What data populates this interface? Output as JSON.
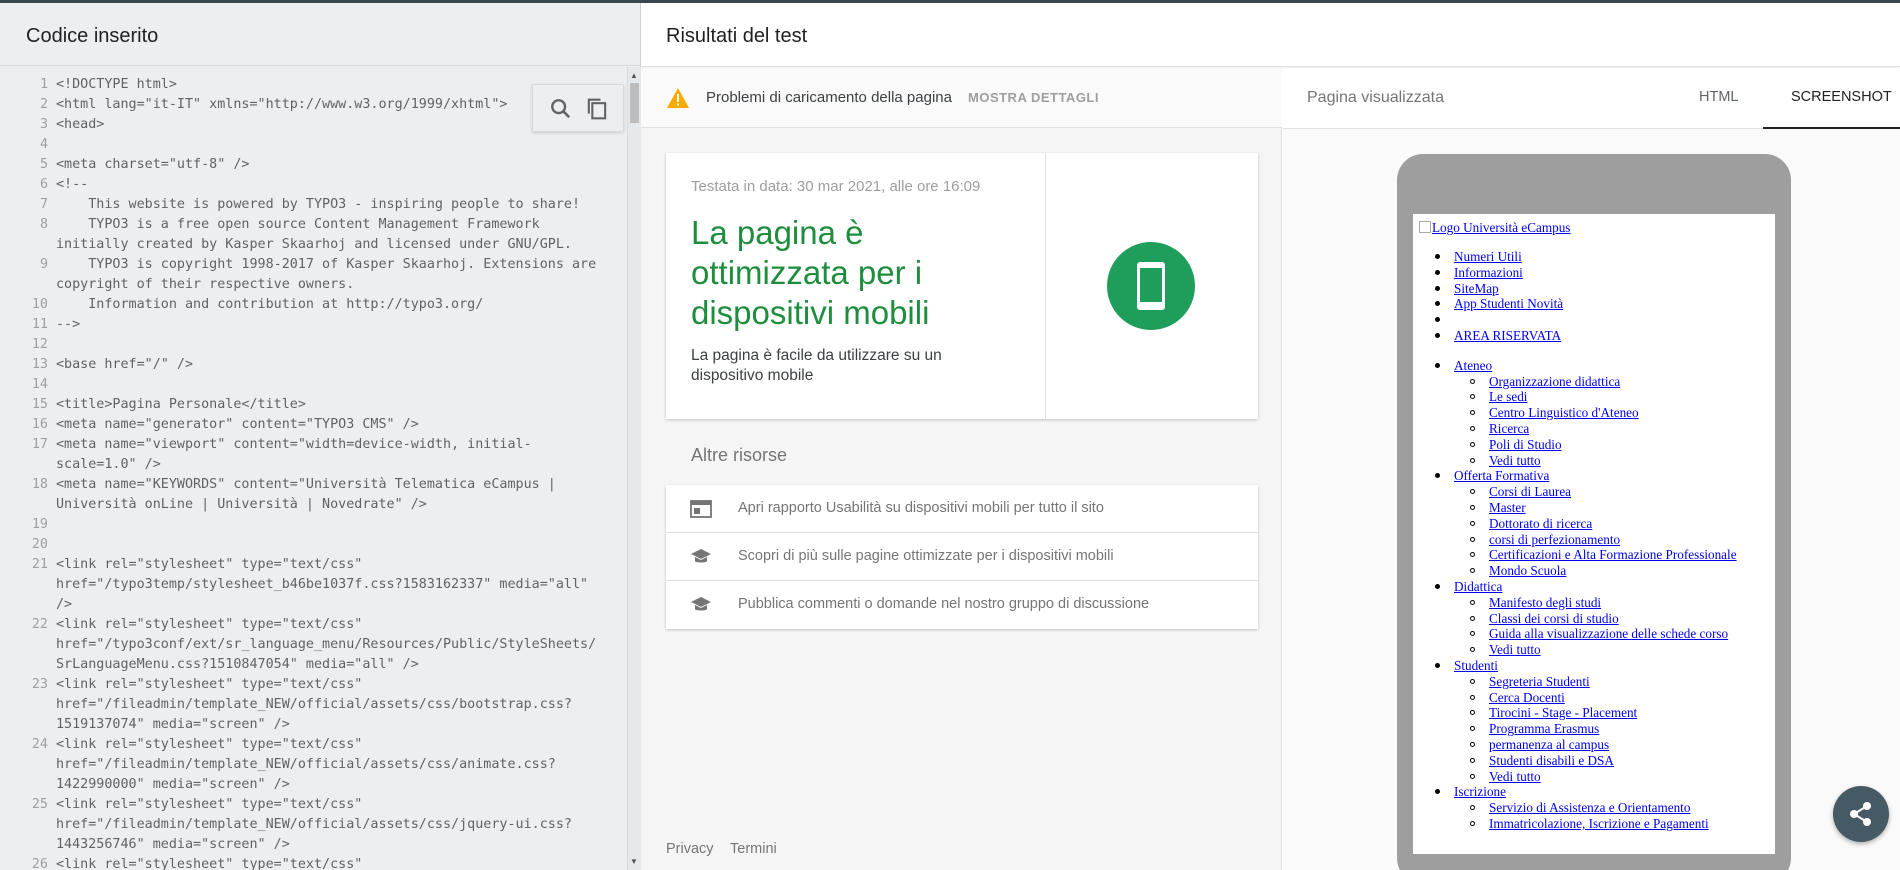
{
  "left_panel": {
    "title": "Codice inserito",
    "code_lines": [
      {
        "n": "1",
        "t": "<!DOCTYPE html>"
      },
      {
        "n": "2",
        "t": "<html lang=\"it-IT\" xmlns=\"http://www.w3.org/1999/xhtml\">"
      },
      {
        "n": "3",
        "t": "<head>"
      },
      {
        "n": "4",
        "t": ""
      },
      {
        "n": "5",
        "t": "<meta charset=\"utf-8\" />"
      },
      {
        "n": "6",
        "t": "<!--"
      },
      {
        "n": "7",
        "t": "    This website is powered by TYPO3 - inspiring people to share!"
      },
      {
        "n": "8",
        "t": "    TYPO3 is a free open source Content Management Framework"
      },
      {
        "n": "",
        "t": "initially created by Kasper Skaarhoj and licensed under GNU/GPL."
      },
      {
        "n": "9",
        "t": "    TYPO3 is copyright 1998-2017 of Kasper Skaarhoj. Extensions are"
      },
      {
        "n": "",
        "t": "copyright of their respective owners."
      },
      {
        "n": "10",
        "t": "    Information and contribution at http://typo3.org/"
      },
      {
        "n": "11",
        "t": "-->"
      },
      {
        "n": "12",
        "t": ""
      },
      {
        "n": "13",
        "t": "<base href=\"/\" />"
      },
      {
        "n": "14",
        "t": ""
      },
      {
        "n": "15",
        "t": "<title>Pagina Personale</title>"
      },
      {
        "n": "16",
        "t": "<meta name=\"generator\" content=\"TYPO3 CMS\" />"
      },
      {
        "n": "17",
        "t": "<meta name=\"viewport\" content=\"width=device-width, initial-"
      },
      {
        "n": "",
        "t": "scale=1.0\" />"
      },
      {
        "n": "18",
        "t": "<meta name=\"KEYWORDS\" content=\"Università Telematica eCampus |"
      },
      {
        "n": "",
        "t": "Università onLine | Università | Novedrate\" />"
      },
      {
        "n": "19",
        "t": ""
      },
      {
        "n": "20",
        "t": ""
      },
      {
        "n": "21",
        "t": "<link rel=\"stylesheet\" type=\"text/css\""
      },
      {
        "n": "",
        "t": "href=\"/typo3temp/stylesheet_b46be1037f.css?1583162337\" media=\"all\""
      },
      {
        "n": "",
        "t": "/>"
      },
      {
        "n": "22",
        "t": "<link rel=\"stylesheet\" type=\"text/css\""
      },
      {
        "n": "",
        "t": "href=\"/typo3conf/ext/sr_language_menu/Resources/Public/StyleSheets/"
      },
      {
        "n": "",
        "t": "SrLanguageMenu.css?1510847054\" media=\"all\" />"
      },
      {
        "n": "23",
        "t": "<link rel=\"stylesheet\" type=\"text/css\""
      },
      {
        "n": "",
        "t": "href=\"/fileadmin/template_NEW/official/assets/css/bootstrap.css?"
      },
      {
        "n": "",
        "t": "1519137074\" media=\"screen\" />"
      },
      {
        "n": "24",
        "t": "<link rel=\"stylesheet\" type=\"text/css\""
      },
      {
        "n": "",
        "t": "href=\"/fileadmin/template_NEW/official/assets/css/animate.css?"
      },
      {
        "n": "",
        "t": "1422990000\" media=\"screen\" />"
      },
      {
        "n": "25",
        "t": "<link rel=\"stylesheet\" type=\"text/css\""
      },
      {
        "n": "",
        "t": "href=\"/fileadmin/template_NEW/official/assets/css/jquery-ui.css?"
      },
      {
        "n": "",
        "t": "1443256746\" media=\"screen\" />"
      },
      {
        "n": "26",
        "t": "<link rel=\"stylesheet\" type=\"text/css\""
      }
    ]
  },
  "right_panel": {
    "title": "Risultati del test",
    "warning": {
      "text": "Problemi di caricamento della pagina",
      "action": "MOSTRA DETTAGLI",
      "color": "#f9ab00"
    },
    "result": {
      "date": "Testata in data: 30 mar 2021, alle ore 16:09",
      "verdict": "La pagina è ottimizzata per i dispositivi mobili",
      "subtitle": "La pagina è facile da utilizzare su un dispositivo mobile",
      "color": "#1e8e3e"
    },
    "resources": {
      "title": "Altre risorse",
      "items": [
        {
          "label": "Apri rapporto Usabilità su dispositivi mobili per tutto il sito",
          "icon": "browser-window-icon"
        },
        {
          "label": "Scopri di più sulle pagine ottimizzate per i dispositivi mobili",
          "icon": "school-icon"
        },
        {
          "label": "Pubblica commenti o domande nel nostro gruppo di discussione",
          "icon": "school-icon"
        }
      ]
    },
    "footer": {
      "privacy": "Privacy",
      "terms": "Termini"
    },
    "preview": {
      "label": "Pagina visualizzata",
      "tabs": [
        "HTML",
        "SCREENSHOT"
      ],
      "active_tab": "SCREENSHOT",
      "logo_alt": "Logo Università eCampus",
      "top_links": [
        "Numeri Utili",
        "Informazioni",
        "SiteMap",
        "App Studenti Novità",
        "",
        "AREA RISERVATA"
      ],
      "menu": [
        {
          "label": "Ateneo",
          "children": [
            "Organizzazione didattica",
            "Le sedi",
            "Centro Linguistico d'Ateneo",
            "Ricerca",
            "Poli di Studio",
            "Vedi tutto"
          ]
        },
        {
          "label": "Offerta Formativa",
          "children": [
            "Corsi di Laurea",
            "Master",
            "Dottorato di ricerca",
            "corsi di perfezionamento",
            "Certificazioni e Alta Formazione Professionale",
            "Mondo Scuola"
          ]
        },
        {
          "label": "Didattica",
          "children": [
            "Manifesto degli studi",
            "Classi dei corsi di studio",
            "Guida alla visualizzazione delle schede corso",
            "Vedi tutto"
          ]
        },
        {
          "label": "Studenti",
          "children": [
            "Segreteria Studenti",
            "Cerca Docenti",
            "Tirocini - Stage - Placement",
            "Programma Erasmus",
            "permanenza al campus",
            "Studenti disabili e DSA",
            "Vedi tutto"
          ]
        },
        {
          "label": "Iscrizione",
          "children": [
            "Servizio di Assistenza e Orientamento",
            "Immatricolazione, Iscrizione e Pagamenti"
          ]
        }
      ]
    }
  }
}
